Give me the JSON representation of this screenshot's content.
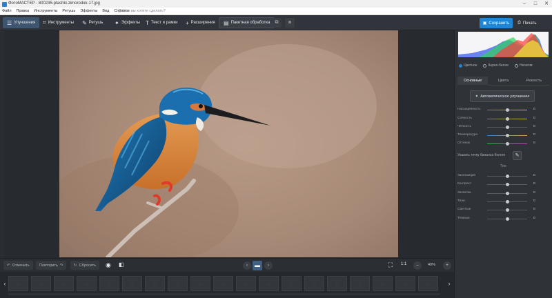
{
  "window": {
    "title": "ФотоМАСТЕР - 800235-ptashki-zimorodok-17.jpg"
  },
  "menu": {
    "items": [
      "Файл",
      "Правка",
      "Инструменты",
      "Ретушь",
      "Эффекты",
      "Вид",
      "Справка"
    ],
    "help_placeholder": "Что вы хотите сделать?"
  },
  "toolbar": {
    "tools": [
      "Улучшения",
      "Инструменты",
      "Ретушь",
      "Эффекты",
      "Текст и рамки",
      "Расширения",
      "Пакетная обработка"
    ],
    "save": "Сохранить",
    "print": "Печать"
  },
  "panel": {
    "modes": [
      "Цветное",
      "Черно-белое",
      "Негатив"
    ],
    "tabs": [
      "Основные",
      "Цвета",
      "Резкость"
    ],
    "auto": "Автоматическое улучшение",
    "sliders_color": [
      {
        "label": "Насыщенность",
        "value": "0"
      },
      {
        "label": "Сочность",
        "value": "0"
      },
      {
        "label": "Чёткость",
        "value": "0"
      },
      {
        "label": "Температура",
        "value": "0"
      },
      {
        "label": "Оттенок",
        "value": "0"
      }
    ],
    "white_point": "Указать точку баланса белого",
    "tone_title": "Тон",
    "sliders_tone": [
      {
        "label": "Экспозиция",
        "value": "0"
      },
      {
        "label": "Контраст",
        "value": "0"
      },
      {
        "label": "Засветки",
        "value": "0"
      },
      {
        "label": "Тени",
        "value": "0"
      },
      {
        "label": "Светлые",
        "value": "0"
      },
      {
        "label": "Тёмные",
        "value": "0"
      }
    ]
  },
  "bottom": {
    "undo": "Отменить",
    "redo": "Повторить",
    "reset": "Сбросить",
    "zoom_ratio": "1:1",
    "zoom": "40%"
  },
  "colors": {
    "accent": "#1f86d6",
    "panel": "#2f3338",
    "toolbar": "#31353b"
  }
}
